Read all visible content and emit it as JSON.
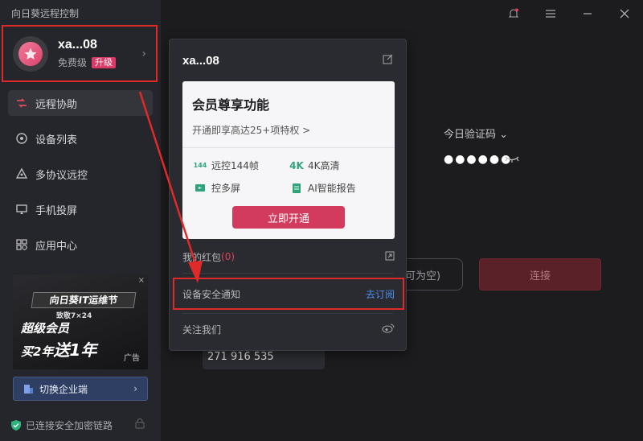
{
  "app": {
    "title": "向日葵远程控制"
  },
  "profile": {
    "name": "xa...08",
    "tier": "免费级",
    "upgrade": "升级"
  },
  "nav": [
    {
      "label": "远程协助",
      "icon": "remote-assist-icon"
    },
    {
      "label": "设备列表",
      "icon": "device-list-icon"
    },
    {
      "label": "多协议远控",
      "icon": "multi-protocol-icon"
    },
    {
      "label": "手机投屏",
      "icon": "screen-cast-icon"
    },
    {
      "label": "应用中心",
      "icon": "app-center-icon"
    }
  ],
  "ad": {
    "banner": "向日葵IT运维节",
    "sub": "致敬7×24",
    "line1": "超级会员",
    "line2_prefix": "买2年",
    "line2_big": "送1年",
    "tag": "广告",
    "close": "×"
  },
  "switch": {
    "label": "切换企业端",
    "chevron": "›"
  },
  "status": {
    "secure": "已连接安全加密链路"
  },
  "main": {
    "verify_label": "今日验证码",
    "code_dots": "●●●●●●",
    "partner_placeholder": "可为空)",
    "connect": "连接",
    "device_id": "271 916 535"
  },
  "popup": {
    "name": "xa...08",
    "vip_title": "会员尊享功能",
    "vip_sub": "开通即享高达25+项特权 >",
    "features": [
      {
        "icon": "144",
        "label": "远控144帧"
      },
      {
        "icon": "4K",
        "label": "4K高清"
      },
      {
        "icon": "screen",
        "label": "控多屏"
      },
      {
        "icon": "report",
        "label": "AI智能报告"
      }
    ],
    "open_btn": "立即开通",
    "red_packet_label": "我的红包",
    "red_packet_count": "(0)",
    "notify_label": "设备安全通知",
    "notify_action": "去订阅",
    "follow_label": "关注我们"
  },
  "colors": {
    "accent": "#d23b5e",
    "highlight": "#e02a2a",
    "link": "#4f8ff0"
  }
}
